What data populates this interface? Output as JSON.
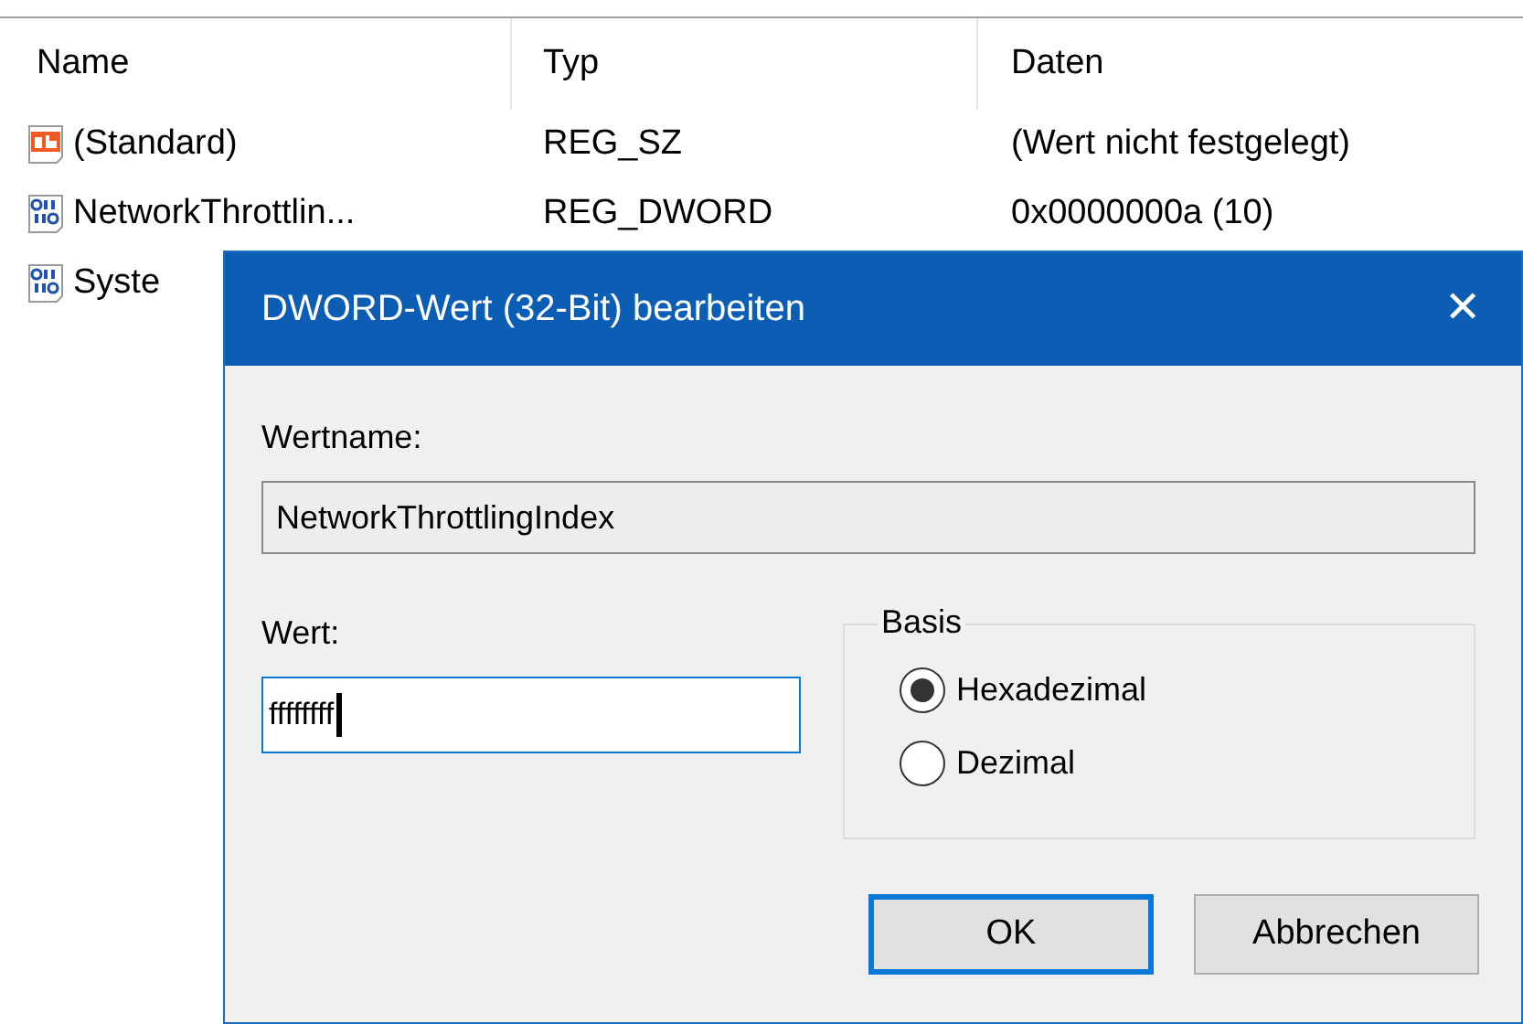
{
  "list": {
    "columns": [
      "Name",
      "Typ",
      "Daten"
    ],
    "rows": [
      {
        "kind": "string",
        "name": "(Standard)",
        "type": "REG_SZ",
        "data": "(Wert nicht festgelegt)"
      },
      {
        "kind": "binary",
        "name": "NetworkThrottlin...",
        "type": "REG_DWORD",
        "data": "0x0000000a (10)"
      },
      {
        "kind": "binary",
        "name": "Syste"
      }
    ]
  },
  "dialog": {
    "title": "DWORD-Wert (32-Bit) bearbeiten",
    "close": "✕",
    "name_label": "Wertname:",
    "name_value": "NetworkThrottlingIndex",
    "value_label": "Wert:",
    "value": "ffffffff",
    "base": {
      "title": "Basis",
      "options": [
        {
          "label": "Hexadezimal",
          "selected": true
        },
        {
          "label": "Dezimal",
          "selected": false
        }
      ]
    },
    "buttons": [
      {
        "label": "OK",
        "default": true
      },
      {
        "label": "Abbrechen",
        "default": false
      }
    ]
  }
}
